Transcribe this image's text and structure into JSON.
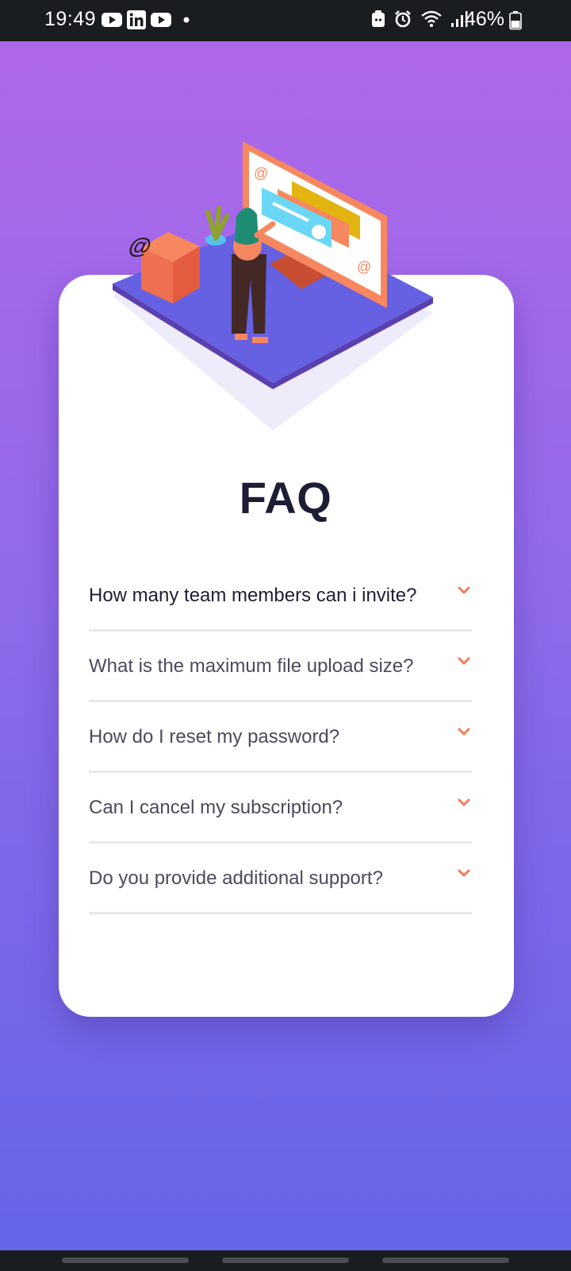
{
  "status_bar": {
    "time": "19:49",
    "battery_percent": "46%",
    "notification_icons": [
      "youtube-icon",
      "linkedin-icon",
      "youtube-icon",
      "dot-icon"
    ],
    "system_icons": [
      "vpn-icon",
      "alarm-icon",
      "wifi-icon",
      "signal-icon",
      "battery-icon"
    ]
  },
  "page": {
    "title": "FAQ"
  },
  "faq": {
    "items": [
      {
        "question": "How many team members can i invite?"
      },
      {
        "question": "What is the maximum file upload size?"
      },
      {
        "question": "How do I reset my password?"
      },
      {
        "question": "Can I cancel my subscription?"
      },
      {
        "question": "Do you provide additional support?"
      }
    ]
  },
  "colors": {
    "bg_gradient_top": "#af67e9",
    "bg_gradient_bottom": "#6565e7",
    "card": "#ffffff",
    "title": "#1d1e35",
    "question": "#4a4b5e",
    "chevron": "#f47c57",
    "divider": "#e8e8ea"
  }
}
